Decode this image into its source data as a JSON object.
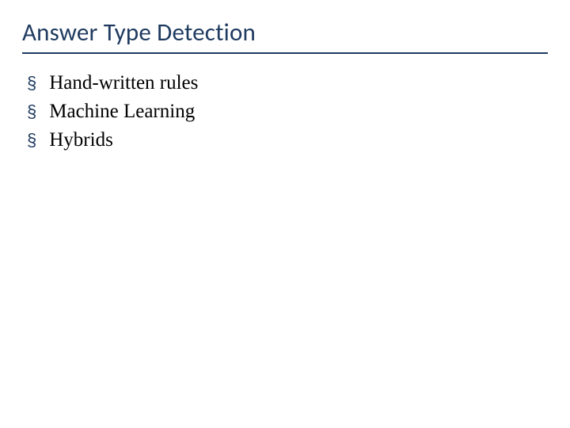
{
  "title": "Answer Type Detection",
  "bullets": {
    "b0": "Hand-written rules",
    "b1": "Machine Learning",
    "b2": "Hybrids"
  },
  "marker": "§"
}
